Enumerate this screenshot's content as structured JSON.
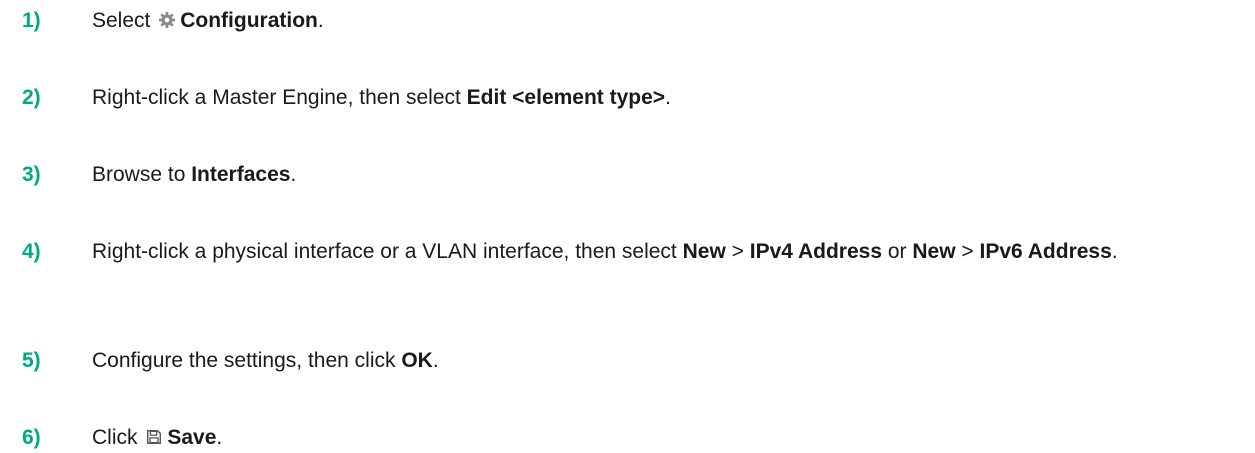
{
  "steps": [
    {
      "number": "1)",
      "pre": "Select",
      "icon": "gear-icon",
      "bold": "Configuration",
      "post": "."
    },
    {
      "number": "2)",
      "pre": "Right-click a Master Engine, then select ",
      "bold": "Edit <element type>",
      "post": "."
    },
    {
      "number": "3)",
      "pre": "Browse to ",
      "bold": "Interfaces",
      "post": "."
    },
    {
      "number": "4)",
      "pre": "Right-click a physical interface or a VLAN interface, then select ",
      "bold1": "New",
      "sep1": " > ",
      "bold2": "IPv4 Address",
      "mid": " or ",
      "bold3": "New",
      "sep2": " > ",
      "bold4": "IPv6 Address",
      "post": "."
    },
    {
      "number": "5)",
      "pre": "Configure the settings, then click ",
      "bold": "OK",
      "post": "."
    },
    {
      "number": "6)",
      "pre": "Click",
      "icon": "save-icon",
      "bold": "Save",
      "post": "."
    }
  ],
  "colors": {
    "step_number": "#01a982",
    "text": "#1a1a1a"
  }
}
